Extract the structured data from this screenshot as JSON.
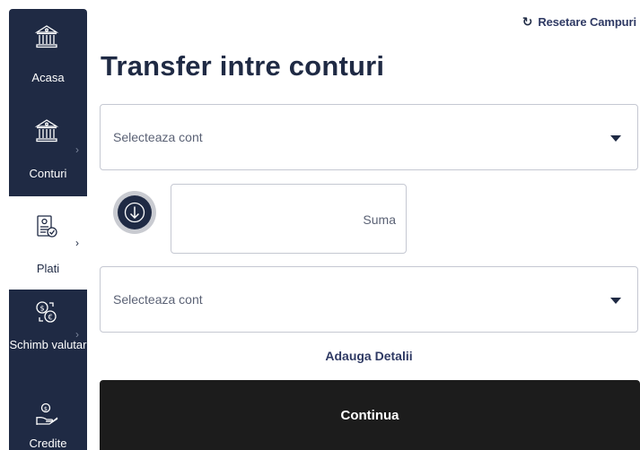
{
  "sidebar": {
    "items": [
      {
        "label": "Acasa",
        "icon": "bank-icon",
        "active": false,
        "has_chevron": false
      },
      {
        "label": "Conturi",
        "icon": "accounts-icon",
        "active": false,
        "has_chevron": true
      },
      {
        "label": "Plati",
        "icon": "payments-icon",
        "active": true,
        "has_chevron": true
      },
      {
        "label": "Schimb valutar",
        "icon": "currency-exchange-icon",
        "active": false,
        "has_chevron": true
      },
      {
        "label": "Credite",
        "icon": "credit-hand-icon",
        "active": false,
        "has_chevron": false
      }
    ],
    "chevron": "›"
  },
  "header": {
    "reset_label": "Resetare Campuri",
    "reset_icon": "refresh-icon"
  },
  "main": {
    "title": "Transfer intre conturi",
    "source_account": {
      "placeholder": "Selecteaza cont"
    },
    "swap_icon": "arrow-down-icon",
    "amount": {
      "placeholder": "Suma",
      "value": ""
    },
    "destination_account": {
      "placeholder": "Selecteaza cont"
    },
    "add_details_label": "Adauga Detalii",
    "continue_label": "Continua"
  },
  "colors": {
    "sidebar_bg": "#1f2a44",
    "primary_text": "#1f2a44",
    "link": "#2f3a64",
    "continue_bg": "#1c1c1c",
    "border": "#c5c8d2"
  }
}
